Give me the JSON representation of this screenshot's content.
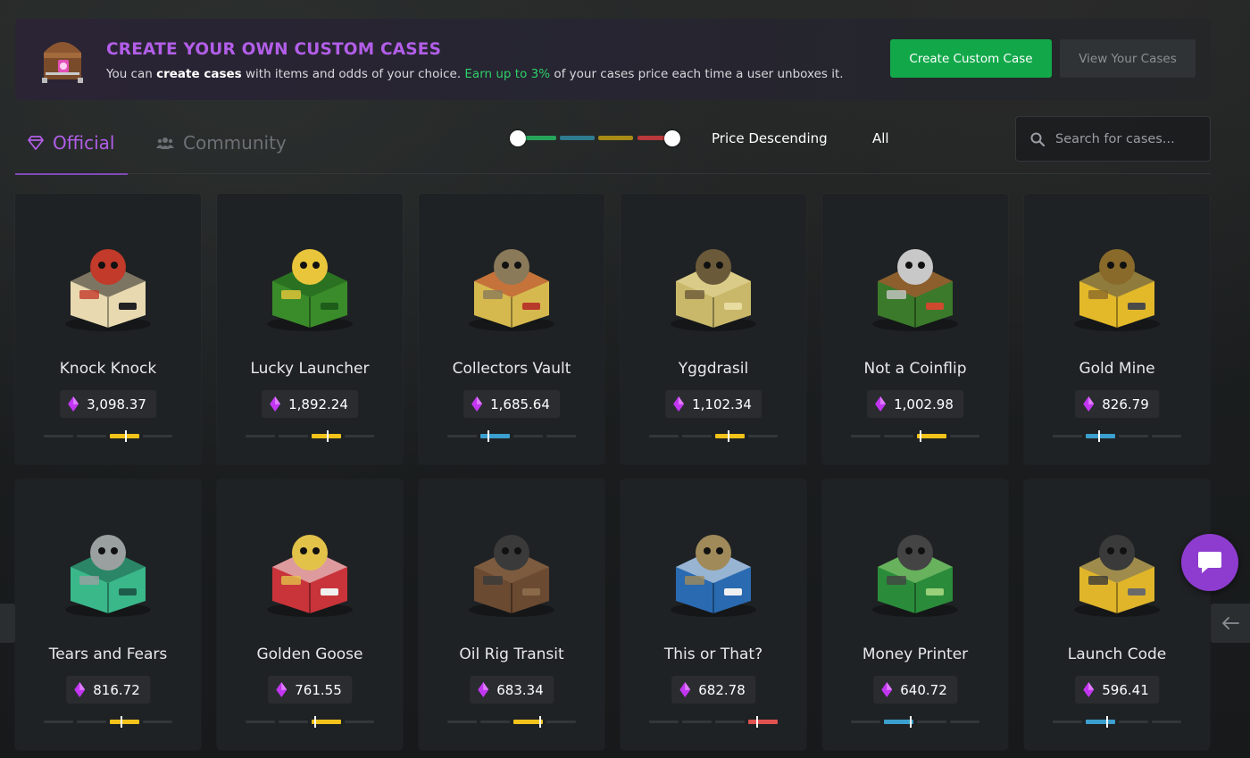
{
  "banner": {
    "title": "CREATE YOUR OWN CUSTOM CASES",
    "desc_part1": "You can ",
    "desc_bold": "create cases",
    "desc_part2": " with items and odds of your choice. ",
    "desc_green": "Earn up to 3%",
    "desc_part3": " of your cases price each time a user unboxes it.",
    "create_button": "Create Custom Case",
    "view_button": "View Your Cases",
    "icon": "treasure-chest-icon"
  },
  "tabs": {
    "official": "Official",
    "community": "Community",
    "official_icon": "diamond-icon",
    "community_icon": "users-icon"
  },
  "filters": {
    "sort": "Price Descending",
    "category": "All",
    "search_placeholder": "Search for cases..."
  },
  "colors": {
    "accent": "#b25ee8",
    "green": "#12a84a",
    "rarity_green": "#26a55a",
    "rarity_blue": "#3b9fcf",
    "rarity_yellow": "#f2c31a",
    "rarity_red": "#e0524f",
    "gem": "#c236f2"
  },
  "cases": [
    {
      "name": "Knock Knock",
      "price": "3,098.37",
      "rarity": "yellow",
      "seg": 2,
      "level": 0.55
    },
    {
      "name": "Lucky Launcher",
      "price": "1,892.24",
      "rarity": "yellow",
      "seg": 2,
      "level": 0.55
    },
    {
      "name": "Collectors Vault",
      "price": "1,685.64",
      "rarity": "blue",
      "seg": 1,
      "level": 0.25
    },
    {
      "name": "Yggdrasil",
      "price": "1,102.34",
      "rarity": "yellow",
      "seg": 2,
      "level": 0.45
    },
    {
      "name": "Not a Coinflip",
      "price": "1,002.98",
      "rarity": "yellow",
      "seg": 2,
      "level": 0.1
    },
    {
      "name": "Gold Mine",
      "price": "826.79",
      "rarity": "blue",
      "seg": 1,
      "level": 0.45
    },
    {
      "name": "Tears and Fears",
      "price": "816.72",
      "rarity": "yellow",
      "seg": 2,
      "level": 0.4
    },
    {
      "name": "Golden Goose",
      "price": "761.55",
      "rarity": "yellow",
      "seg": 2,
      "level": 0.1
    },
    {
      "name": "Oil Rig Transit",
      "price": "683.34",
      "rarity": "yellow",
      "seg": 2,
      "level": 0.95
    },
    {
      "name": "This or That?",
      "price": "682.78",
      "rarity": "red",
      "seg": 3,
      "level": 0.3
    },
    {
      "name": "Money Printer",
      "price": "640.72",
      "rarity": "blue",
      "seg": 1,
      "level": 0.95
    },
    {
      "name": "Launch Code",
      "price": "596.41",
      "rarity": "blue",
      "seg": 1,
      "level": 0.75
    }
  ],
  "chat_icon": "chat-bubble-icon",
  "nav_left_icon": "arrow-left-icon",
  "nav_right_icon": "arrow-left-icon"
}
